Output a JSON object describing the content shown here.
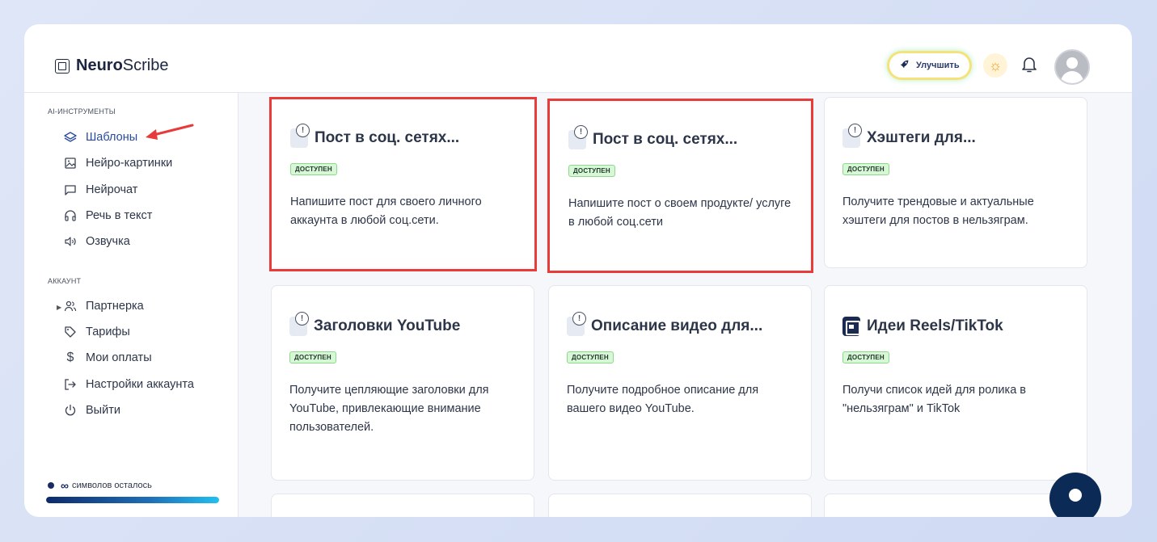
{
  "app": {
    "logo_bold": "Neuro",
    "logo_rest": "Scribe"
  },
  "header": {
    "upgrade_label": "Улучшить"
  },
  "sidebar": {
    "ai_section": "AI-ИНСТРУМЕНТЫ",
    "ai_items": [
      {
        "label": "Шаблоны",
        "icon": "layers-icon"
      },
      {
        "label": "Нейро-картинки",
        "icon": "image-icon"
      },
      {
        "label": "Нейрочат",
        "icon": "chat-icon"
      },
      {
        "label": "Речь в текст",
        "icon": "headphones-icon"
      },
      {
        "label": "Озвучка",
        "icon": "speaker-icon"
      }
    ],
    "account_section": "АККАУНТ",
    "account_items": [
      {
        "label": "Партнерка",
        "icon": "users-icon"
      },
      {
        "label": "Тарифы",
        "icon": "tag-icon"
      },
      {
        "label": "Мои оплаты",
        "icon": "dollar-icon"
      },
      {
        "label": "Настройки аккаунта",
        "icon": "logout-arrow-icon"
      },
      {
        "label": "Выйти",
        "icon": "power-icon"
      }
    ],
    "credits_symbol": "∞",
    "credits_label": "символов осталось"
  },
  "cards": [
    {
      "title": "Пост в соц. сетях...",
      "badge": "ДОСТУПЕН",
      "desc": "Напишите пост для своего личного аккаунта в любой соц.сети.",
      "icon": "notice-icon"
    },
    {
      "title": "Пост в соц. сетях...",
      "badge": "ДОСТУПЕН",
      "desc": "Напишите пост о своем продукте/ услуге в любой соц.сети",
      "icon": "notice-icon"
    },
    {
      "title": "Хэштеги для...",
      "badge": "ДОСТУПЕН",
      "desc": "Получите трендовые и актуальные хэштеги для постов в нельзяграм.",
      "icon": "notice-icon"
    },
    {
      "title": "Заголовки YouTube",
      "badge": "ДОСТУПЕН",
      "desc": "Получите цепляющие заголовки для YouTube, привлекающие внимание пользователей.",
      "icon": "notice-icon"
    },
    {
      "title": "Описание видео для...",
      "badge": "ДОСТУПЕН",
      "desc": "Получите подробное описание для вашего видео YouTube.",
      "icon": "notice-icon"
    },
    {
      "title": "Идеи Reels/TikTok",
      "badge": "ДОСТУПЕН",
      "desc": "Получи список идей для ролика в \"нельзяграм\" и TikTok",
      "icon": "film-icon"
    }
  ],
  "colors": {
    "accent": "#2a4a9c",
    "highlight": "#ea3b3b",
    "badge_bg": "#d8f7d6"
  }
}
